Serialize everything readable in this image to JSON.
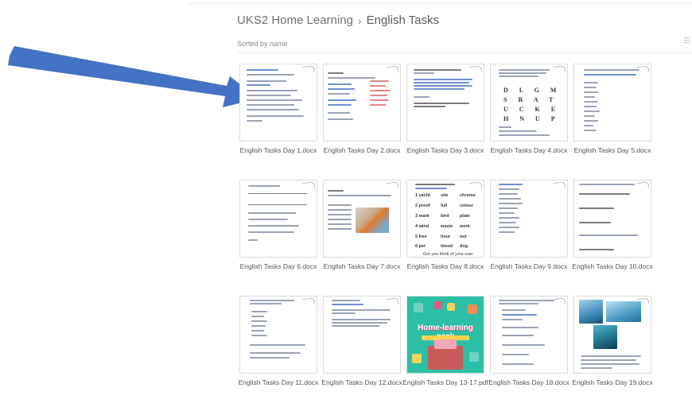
{
  "breadcrumb": {
    "parent": "UKS2 Home Learning",
    "separator": "›",
    "current": "English Tasks"
  },
  "sort_label": "Sorted by name",
  "accent_colors": {
    "arrow": "#4472c4",
    "pdf_background": "#2bbfa6"
  },
  "files": [
    {
      "name": "English Tasks Day 1.docx"
    },
    {
      "name": "English Tasks Day 2.docx"
    },
    {
      "name": "English Tasks Day 3.docx"
    },
    {
      "name": "English Tasks Day 4.docx"
    },
    {
      "name": "English Tasks Day 5.docx"
    },
    {
      "name": "English Tasks Day 6.docx"
    },
    {
      "name": "English Tasks Day 7.docx"
    },
    {
      "name": "English Tasks Day 8.docx"
    },
    {
      "name": "English Tasks Day 9.docx"
    },
    {
      "name": "English Tasks Day 10.docx"
    },
    {
      "name": "English Tasks Day 11.docx"
    },
    {
      "name": "English Tasks Day 12.docx"
    },
    {
      "name": "English Tasks Day 13-17.pdf"
    },
    {
      "name": "English Tasks Day 18.docx"
    },
    {
      "name": "English Tasks Day 19.docx"
    }
  ],
  "thumb_text": {
    "day4_grid": [
      "D L G M",
      "S R A T",
      "U C K E",
      "H N U P"
    ],
    "day8_words": [
      [
        "1 yacht",
        "site",
        "chrome"
      ],
      [
        "2 proof",
        "full",
        "colour"
      ],
      [
        "3 mark",
        "bird",
        "plate"
      ],
      [
        "4 wind",
        "waste",
        "work"
      ],
      [
        "5 free",
        "hour",
        "out"
      ],
      [
        "6 pet",
        "blood",
        "dog"
      ]
    ],
    "day8_footer": "Got you think of your own",
    "pdf_title": "Home-learning pack"
  }
}
